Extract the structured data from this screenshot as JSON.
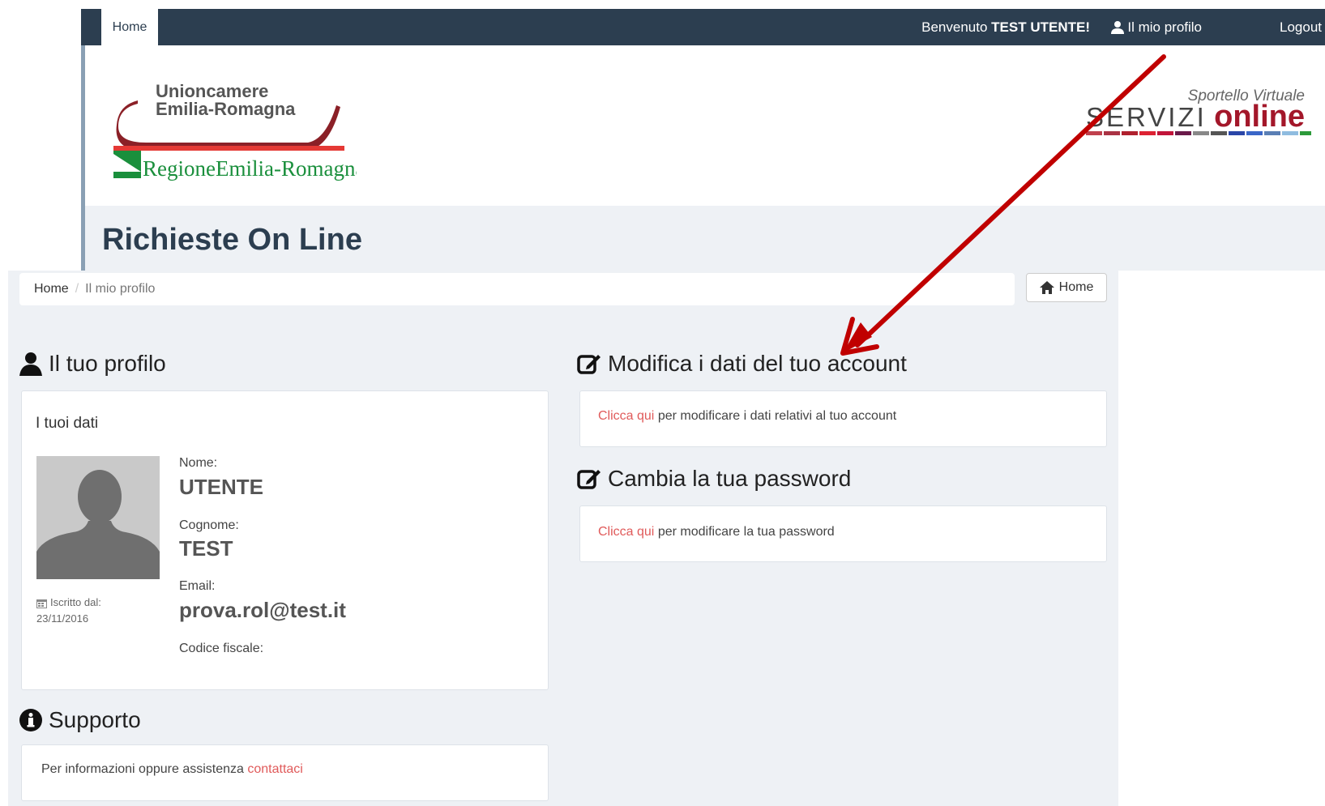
{
  "navbar": {
    "home_tab": "Home",
    "welcome_prefix": "Benvenuto",
    "welcome_user": "TEST UTENTE!",
    "profile_link": "Il mio profilo",
    "logout_link": "Logout"
  },
  "header": {
    "logo_left_line1": "Unioncamere",
    "logo_left_line2": "Emilia-Romagna",
    "logo_left_line3": "RegioneEmilia-Romagna",
    "logo_right_tagline": "Sportello Virtuale",
    "logo_right_part1": "SERVIZI",
    "logo_right_part2": "online",
    "page_title": "Richieste On Line"
  },
  "breadcrumb": {
    "home": "Home",
    "separator": "/",
    "current": "Il mio profilo"
  },
  "home_button": "Home",
  "profile": {
    "section_title": "Il tuo profilo",
    "card_title": "I tuoi dati",
    "since_label": "Iscritto dal:",
    "since_date": "23/11/2016",
    "fields": {
      "nome_label": "Nome:",
      "nome_value": "UTENTE",
      "cognome_label": "Cognome:",
      "cognome_value": "TEST",
      "email_label": "Email:",
      "email_value": "prova.rol@test.it",
      "cf_label": "Codice fiscale:"
    }
  },
  "support": {
    "section_title": "Supporto",
    "text": "Per informazioni oppure assistenza",
    "link": "contattaci"
  },
  "edit_account": {
    "section_title": "Modifica i dati del tuo account",
    "link": "Clicca qui",
    "text": "per modificare i dati relativi al tuo account"
  },
  "change_password": {
    "section_title": "Cambia la tua password",
    "link": "Clicca qui",
    "text": "per modificare la tua password"
  },
  "colors": {
    "navbar": "#2c3e50",
    "link": "#e05a5a",
    "arrow": "#c00000",
    "panel_bg": "#eef1f5"
  }
}
